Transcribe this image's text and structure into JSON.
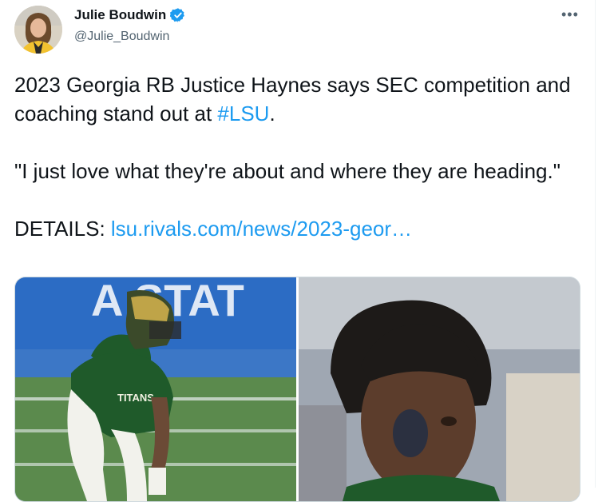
{
  "author": {
    "display_name": "Julie Boudwin",
    "handle": "@Julie_Boudwin",
    "verified": true,
    "avatar_icon": "profile-photo"
  },
  "more_icon": "ellipsis-icon",
  "more_glyph": "•••",
  "tweet": {
    "line1_text": "2023 Georgia RB Justice Haynes says SEC competition and coaching stand out at ",
    "hashtag": "#LSU",
    "line1_end": ".",
    "quote": "\"I just love what they're about and where they are heading.\"",
    "details_label": "DETAILS: ",
    "details_link": "lsu.rivals.com/news/2023-geor…"
  },
  "media": {
    "photos": [
      {
        "name": "football-player-stance-photo",
        "banner_text": "A STAT",
        "jersey_text": "TITANS"
      },
      {
        "name": "player-portrait-photo"
      }
    ]
  },
  "colors": {
    "link": "#1d9bf0",
    "verified": "#1d9bf0",
    "jersey_green": "#1f5a2a",
    "banner_blue": "#2c6cc4"
  }
}
